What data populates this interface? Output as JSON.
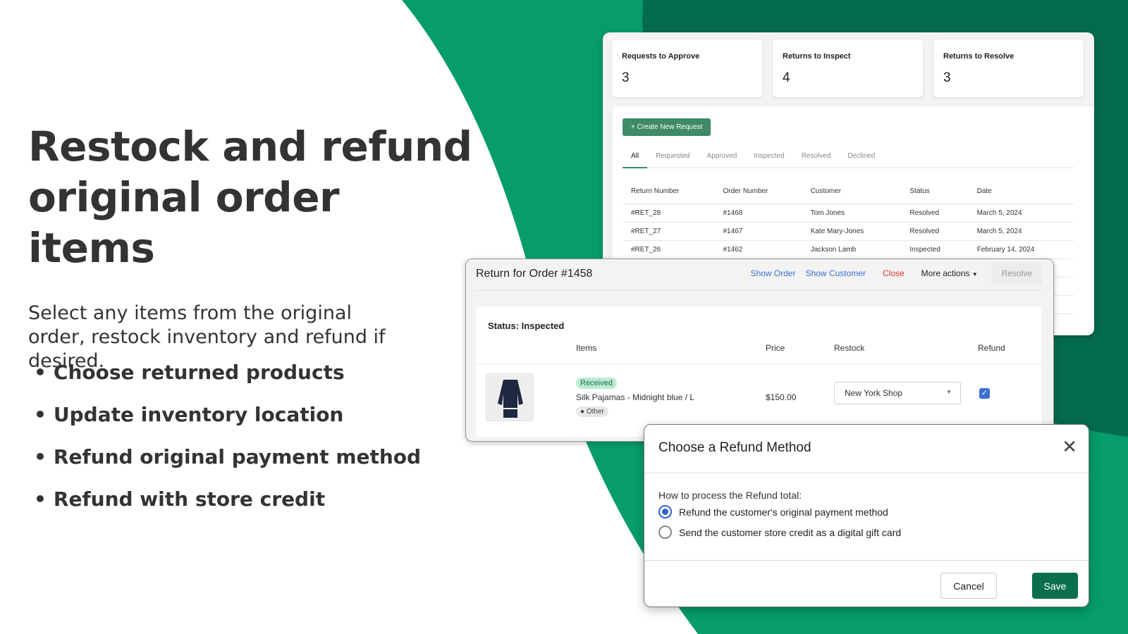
{
  "colors": {
    "brand_green": "#069c6c",
    "dark_green": "#046b4c",
    "button_green": "#0b6e4f",
    "link_blue": "#3b6fd1",
    "close_red": "#d63a2a"
  },
  "hero": {
    "title": "Restock and refund original order items",
    "subtitle": "Select any items from the original order, restock inventory and refund if desired.",
    "bullets": [
      "Choose returned products",
      "Update inventory location",
      "Refund original payment method",
      "Refund with store credit"
    ]
  },
  "dashboard": {
    "stats": [
      {
        "label": "Requests to Approve",
        "value": "3"
      },
      {
        "label": "Returns to Inspect",
        "value": "4"
      },
      {
        "label": "Returns to Resolve",
        "value": "3"
      }
    ],
    "create_button": "+ Create New Request",
    "tabs": [
      "All",
      "Requested",
      "Approved",
      "Inspected",
      "Resolved",
      "Declined"
    ],
    "active_tab": "All",
    "columns": [
      "Return Number",
      "Order Number",
      "Customer",
      "Status",
      "Date"
    ],
    "rows": [
      [
        "#RET_28",
        "#1468",
        "Tom Jones",
        "Resolved",
        "March 5, 2024"
      ],
      [
        "#RET_27",
        "#1467",
        "Kate Mary-Jones",
        "Resolved",
        "March 5, 2024"
      ],
      [
        "#RET_26",
        "#1462",
        "Jackson Lamb",
        "Inspected",
        "February 14, 2024"
      ]
    ]
  },
  "return_panel": {
    "title": "Return for Order #1458",
    "actions": {
      "show_order": "Show Order",
      "show_customer": "Show Customer",
      "close": "Close",
      "more_actions": "More actions",
      "resolve": "Resolve"
    },
    "status": "Status: Inspected",
    "columns": {
      "items": "Items",
      "price": "Price",
      "restock": "Restock",
      "refund": "Refund"
    },
    "item": {
      "badge": "Received",
      "name": "Silk Pajamas - Midnight blue / L",
      "reason": "Other",
      "price": "$150.00",
      "restock_location": "New York Shop",
      "refund_checked": true
    }
  },
  "dialog": {
    "title": "Choose a Refund Method",
    "question": "How to process the Refund total:",
    "options": [
      {
        "label": "Refund the customer's original payment method",
        "selected": true
      },
      {
        "label": "Send the customer store credit as a digital gift card",
        "selected": false
      }
    ],
    "cancel": "Cancel",
    "save": "Save"
  }
}
